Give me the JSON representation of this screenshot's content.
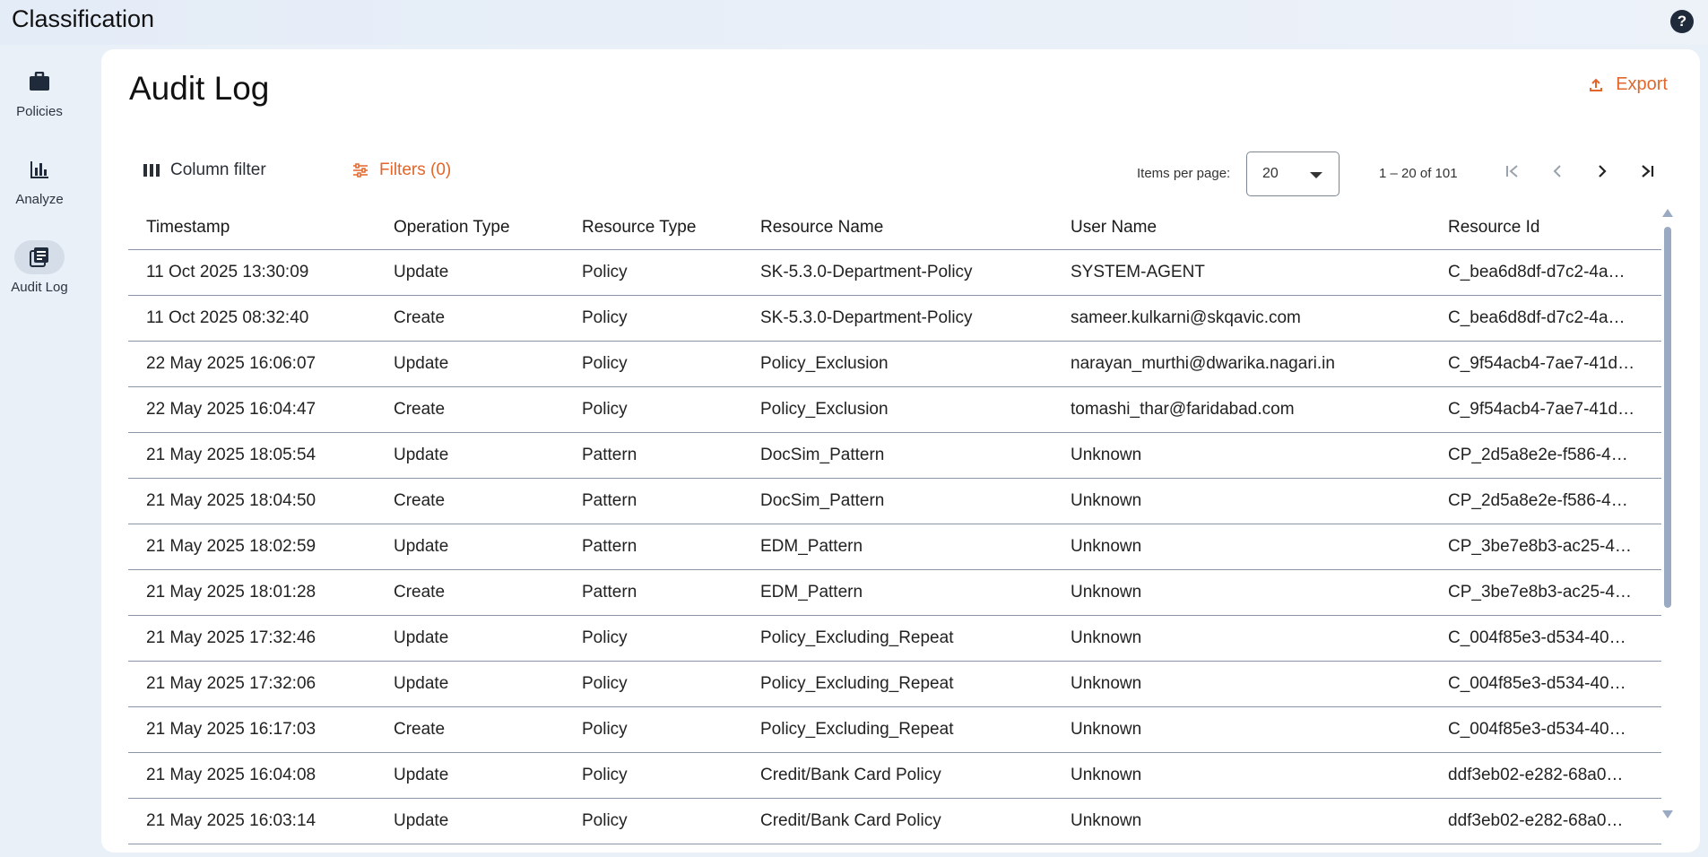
{
  "app": {
    "title": "Classification",
    "help_label": "?"
  },
  "sidebar": {
    "items": [
      {
        "label": "Policies",
        "icon": "briefcase-icon"
      },
      {
        "label": "Analyze",
        "icon": "bar-chart-icon"
      },
      {
        "label": "Audit Log",
        "icon": "audit-log-icon",
        "active": true
      }
    ]
  },
  "page": {
    "title": "Audit Log",
    "export_label": "Export"
  },
  "toolbar": {
    "column_filter_label": "Column filter",
    "filters_label": "Filters (0)"
  },
  "pagination": {
    "items_per_page_label": "Items per page:",
    "items_per_page_value": "20",
    "range_label": "1 – 20 of 101"
  },
  "table": {
    "columns": [
      "Timestamp",
      "Operation Type",
      "Resource Type",
      "Resource Name",
      "User Name",
      "Resource Id"
    ],
    "rows": [
      [
        "11 Oct 2025 13:30:09",
        "Update",
        "Policy",
        "SK-5.3.0-Department-Policy",
        "SYSTEM-AGENT",
        "C_bea6d8df-d7c2-4a…"
      ],
      [
        "11 Oct 2025 08:32:40",
        "Create",
        "Policy",
        "SK-5.3.0-Department-Policy",
        "sameer.kulkarni@skqavic.com",
        "C_bea6d8df-d7c2-4a…"
      ],
      [
        "22 May 2025 16:06:07",
        "Update",
        "Policy",
        "Policy_Exclusion",
        "narayan_murthi@dwarika.nagari.in",
        "C_9f54acb4-7ae7-41d…"
      ],
      [
        "22 May 2025 16:04:47",
        "Create",
        "Policy",
        "Policy_Exclusion",
        "tomashi_thar@faridabad.com",
        "C_9f54acb4-7ae7-41d…"
      ],
      [
        "21 May 2025 18:05:54",
        "Update",
        "Pattern",
        "DocSim_Pattern",
        "Unknown",
        "CP_2d5a8e2e-f586-4…"
      ],
      [
        "21 May 2025 18:04:50",
        "Create",
        "Pattern",
        "DocSim_Pattern",
        "Unknown",
        "CP_2d5a8e2e-f586-4…"
      ],
      [
        "21 May 2025 18:02:59",
        "Update",
        "Pattern",
        "EDM_Pattern",
        "Unknown",
        "CP_3be7e8b3-ac25-4…"
      ],
      [
        "21 May 2025 18:01:28",
        "Create",
        "Pattern",
        "EDM_Pattern",
        "Unknown",
        "CP_3be7e8b3-ac25-4…"
      ],
      [
        "21 May 2025 17:32:46",
        "Update",
        "Policy",
        "Policy_Excluding_Repeat",
        "Unknown",
        "C_004f85e3-d534-40…"
      ],
      [
        "21 May 2025 17:32:06",
        "Update",
        "Policy",
        "Policy_Excluding_Repeat",
        "Unknown",
        "C_004f85e3-d534-40…"
      ],
      [
        "21 May 2025 16:17:03",
        "Create",
        "Policy",
        "Policy_Excluding_Repeat",
        "Unknown",
        "C_004f85e3-d534-40…"
      ],
      [
        "21 May 2025 16:04:08",
        "Update",
        "Policy",
        "Credit/Bank Card Policy",
        "Unknown",
        "ddf3eb02-e282-68a0…"
      ],
      [
        "21 May 2025 16:03:14",
        "Update",
        "Policy",
        "Credit/Bank Card Policy",
        "Unknown",
        "ddf3eb02-e282-68a0…"
      ]
    ]
  },
  "colors": {
    "accent": "#e2662a",
    "background": "#e9f0f8",
    "row_border": "#8b97a8"
  }
}
